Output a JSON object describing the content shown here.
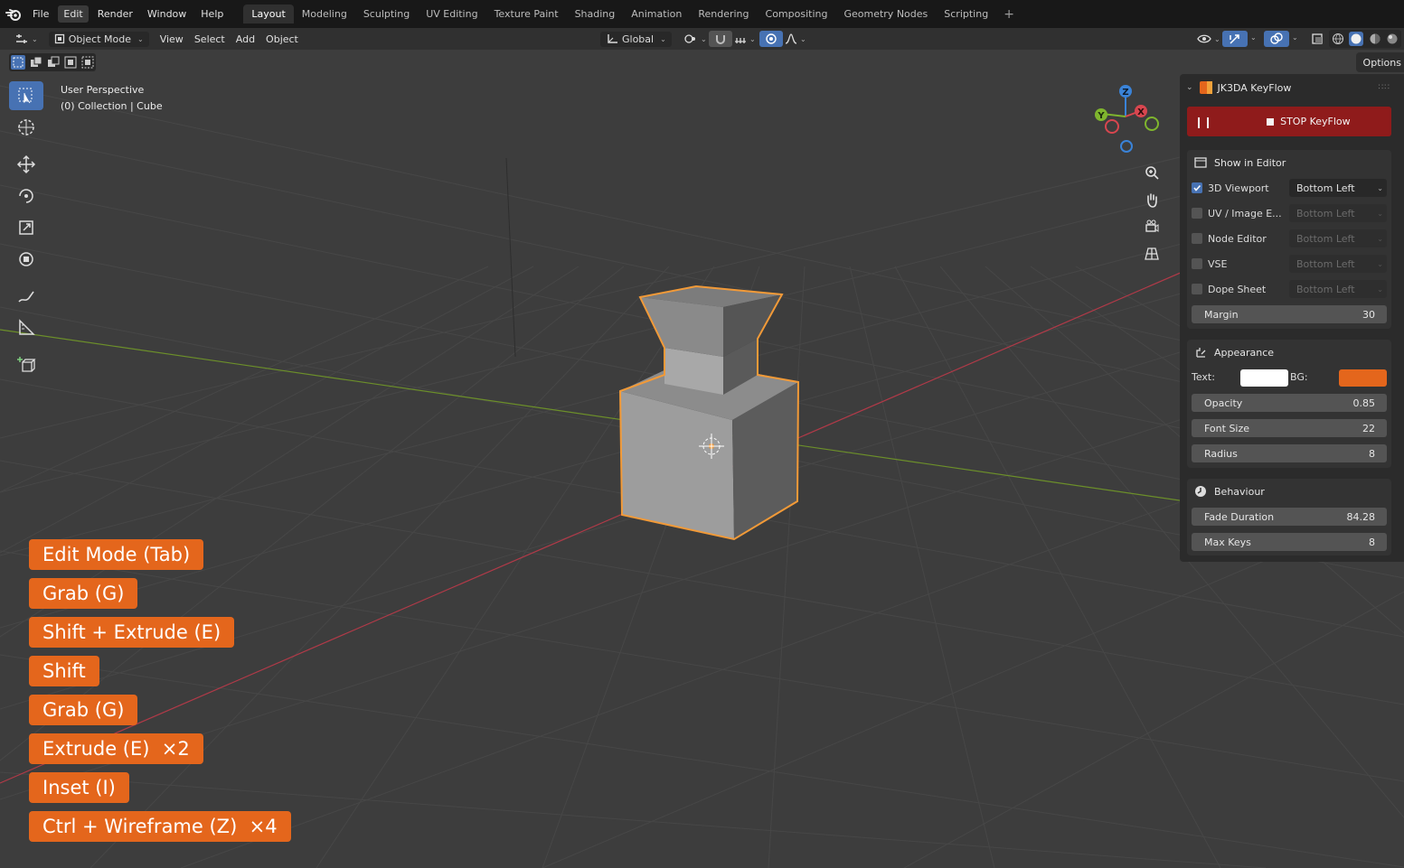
{
  "menubar": {
    "items": [
      "File",
      "Edit",
      "Render",
      "Window",
      "Help"
    ],
    "active_item": "Edit",
    "workspaces": [
      "Layout",
      "Modeling",
      "Sculpting",
      "UV Editing",
      "Texture Paint",
      "Shading",
      "Animation",
      "Rendering",
      "Compositing",
      "Geometry Nodes",
      "Scripting"
    ],
    "active_workspace": "Layout",
    "add_label": "+"
  },
  "header": {
    "mode": "Object Mode",
    "menus": [
      "View",
      "Select",
      "Add",
      "Object"
    ],
    "transform_orientation": "Global"
  },
  "viewport": {
    "perspective_label": "User Perspective",
    "collection_label": "(0) Collection | Cube",
    "gizmo_axes": {
      "x": "X",
      "y": "Y",
      "z": "Z"
    }
  },
  "sidebar": {
    "options_label": "Options",
    "panel_title": "JK3DA KeyFlow",
    "stop_label": "STOP KeyFlow",
    "show_in_editor": {
      "title": "Show in Editor",
      "rows": [
        {
          "label": "3D Viewport",
          "checked": true,
          "position": "Bottom Left",
          "enabled": true
        },
        {
          "label": "UV / Image E...",
          "checked": false,
          "position": "Bottom Left",
          "enabled": false
        },
        {
          "label": "Node Editor",
          "checked": false,
          "position": "Bottom Left",
          "enabled": false
        },
        {
          "label": "VSE",
          "checked": false,
          "position": "Bottom Left",
          "enabled": false
        },
        {
          "label": "Dope Sheet",
          "checked": false,
          "position": "Bottom Left",
          "enabled": false
        }
      ],
      "margin_label": "Margin",
      "margin_value": "30"
    },
    "appearance": {
      "title": "Appearance",
      "text_label": "Text:",
      "bg_label": "BG:",
      "text_color": "#ffffff",
      "bg_color": "#e4661c",
      "opacity_label": "Opacity",
      "opacity_value": "0.85",
      "font_size_label": "Font Size",
      "font_size_value": "22",
      "radius_label": "Radius",
      "radius_value": "8"
    },
    "behaviour": {
      "title": "Behaviour",
      "fade_label": "Fade Duration",
      "fade_value": "84.28",
      "max_keys_label": "Max Keys",
      "max_keys_value": "8"
    }
  },
  "key_overlays": [
    "Edit Mode (Tab)",
    "Grab (G)",
    "Shift + Extrude (E)",
    "Shift",
    "Grab (G)",
    "Extrude (E)  ×2",
    "Inset (I)",
    "Ctrl + Wireframe (Z)  ×4"
  ],
  "colors": {
    "accent_blue": "#4772b3",
    "overlay_orange": "#e4661c",
    "stop_red": "#8f1b1b",
    "selection_orange": "#f29a38"
  }
}
